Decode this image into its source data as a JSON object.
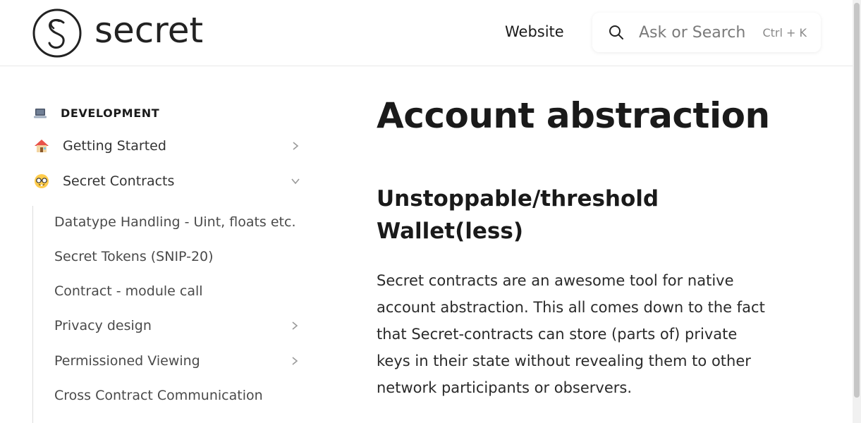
{
  "header": {
    "logo_text": "secret",
    "nav_link": "Website",
    "search": {
      "placeholder": "Ask or Search",
      "shortcut": "Ctrl + K"
    }
  },
  "sidebar": {
    "section": {
      "icon": "laptop-icon",
      "title": "DEVELOPMENT"
    },
    "items": [
      {
        "icon": "house-icon",
        "label": "Getting Started",
        "expanded": false
      },
      {
        "icon": "nerd-face-icon",
        "label": "Secret Contracts",
        "expanded": true
      }
    ],
    "sub_items": [
      {
        "label": "Datatype Handling - Uint, floats etc.",
        "has_children": false
      },
      {
        "label": "Secret Tokens (SNIP-20)",
        "has_children": false
      },
      {
        "label": "Contract - module call",
        "has_children": false
      },
      {
        "label": "Privacy design",
        "has_children": true
      },
      {
        "label": "Permissioned Viewing",
        "has_children": true
      },
      {
        "label": "Cross Contract Communication",
        "has_children": false
      }
    ]
  },
  "main": {
    "title": "Account abstraction",
    "heading": "Unstoppable/threshold Wallet(less)",
    "paragraph": "Secret contracts are an awesome tool for native account abstraction. This all comes down to the fact that Secret-contracts can store (parts of) private keys in their state without revealing them to other network participants or observers."
  },
  "colors": {
    "text": "#1a1a1a",
    "muted": "#7a7a7a",
    "border": "#e8e8e8"
  }
}
